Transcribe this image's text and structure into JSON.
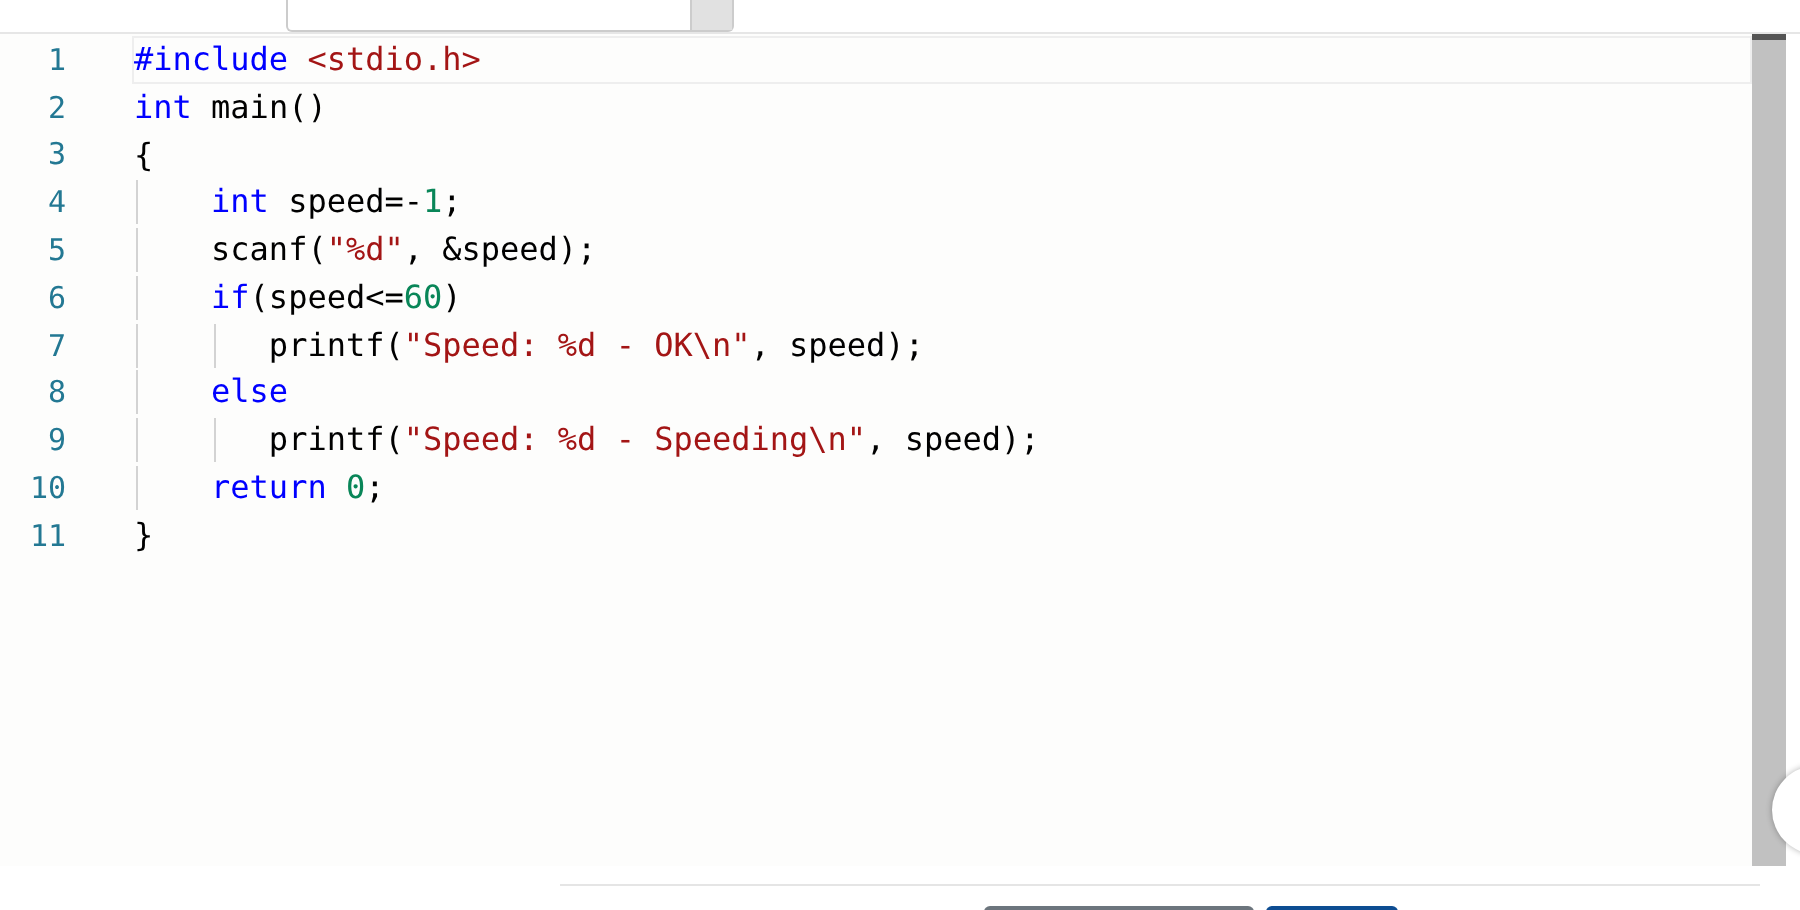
{
  "editor": {
    "lines": [
      {
        "number": "1",
        "current": true,
        "tokens": [
          {
            "kind": "directive",
            "text": "#include"
          },
          {
            "kind": "header",
            "text": " <stdio.h>"
          }
        ]
      },
      {
        "number": "2",
        "current": false,
        "tokens": [
          {
            "kind": "keyword",
            "text": "int"
          },
          {
            "kind": "plain",
            "text": " main()"
          }
        ]
      },
      {
        "number": "3",
        "current": false,
        "tokens": [
          {
            "kind": "plain",
            "text": "{"
          }
        ]
      },
      {
        "number": "4",
        "current": false,
        "tokens": [
          {
            "kind": "keyword",
            "text": "    int"
          },
          {
            "kind": "plain",
            "text": " speed=-"
          },
          {
            "kind": "number",
            "text": "1"
          },
          {
            "kind": "plain",
            "text": ";"
          }
        ]
      },
      {
        "number": "5",
        "current": false,
        "tokens": [
          {
            "kind": "plain",
            "text": "    scanf("
          },
          {
            "kind": "string",
            "text": "\"%d\""
          },
          {
            "kind": "plain",
            "text": ", &speed);"
          }
        ]
      },
      {
        "number": "6",
        "current": false,
        "tokens": [
          {
            "kind": "keyword",
            "text": "    if"
          },
          {
            "kind": "plain",
            "text": "(speed<="
          },
          {
            "kind": "number",
            "text": "60"
          },
          {
            "kind": "plain",
            "text": ")"
          }
        ]
      },
      {
        "number": "7",
        "current": false,
        "tokens": [
          {
            "kind": "plain",
            "text": "       printf("
          },
          {
            "kind": "string",
            "text": "\"Speed: %d - OK\\n\""
          },
          {
            "kind": "plain",
            "text": ", speed);"
          }
        ]
      },
      {
        "number": "8",
        "current": false,
        "tokens": [
          {
            "kind": "keyword",
            "text": "    else"
          }
        ]
      },
      {
        "number": "9",
        "current": false,
        "tokens": [
          {
            "kind": "plain",
            "text": "       printf("
          },
          {
            "kind": "string",
            "text": "\"Speed: %d - Speeding\\n\""
          },
          {
            "kind": "plain",
            "text": ", speed);"
          }
        ]
      },
      {
        "number": "10",
        "current": false,
        "tokens": [
          {
            "kind": "keyword",
            "text": "    return"
          },
          {
            "kind": "number",
            "text": " 0"
          },
          {
            "kind": "plain",
            "text": ";"
          }
        ]
      },
      {
        "number": "11",
        "current": false,
        "tokens": [
          {
            "kind": "plain",
            "text": "}"
          }
        ]
      }
    ]
  }
}
